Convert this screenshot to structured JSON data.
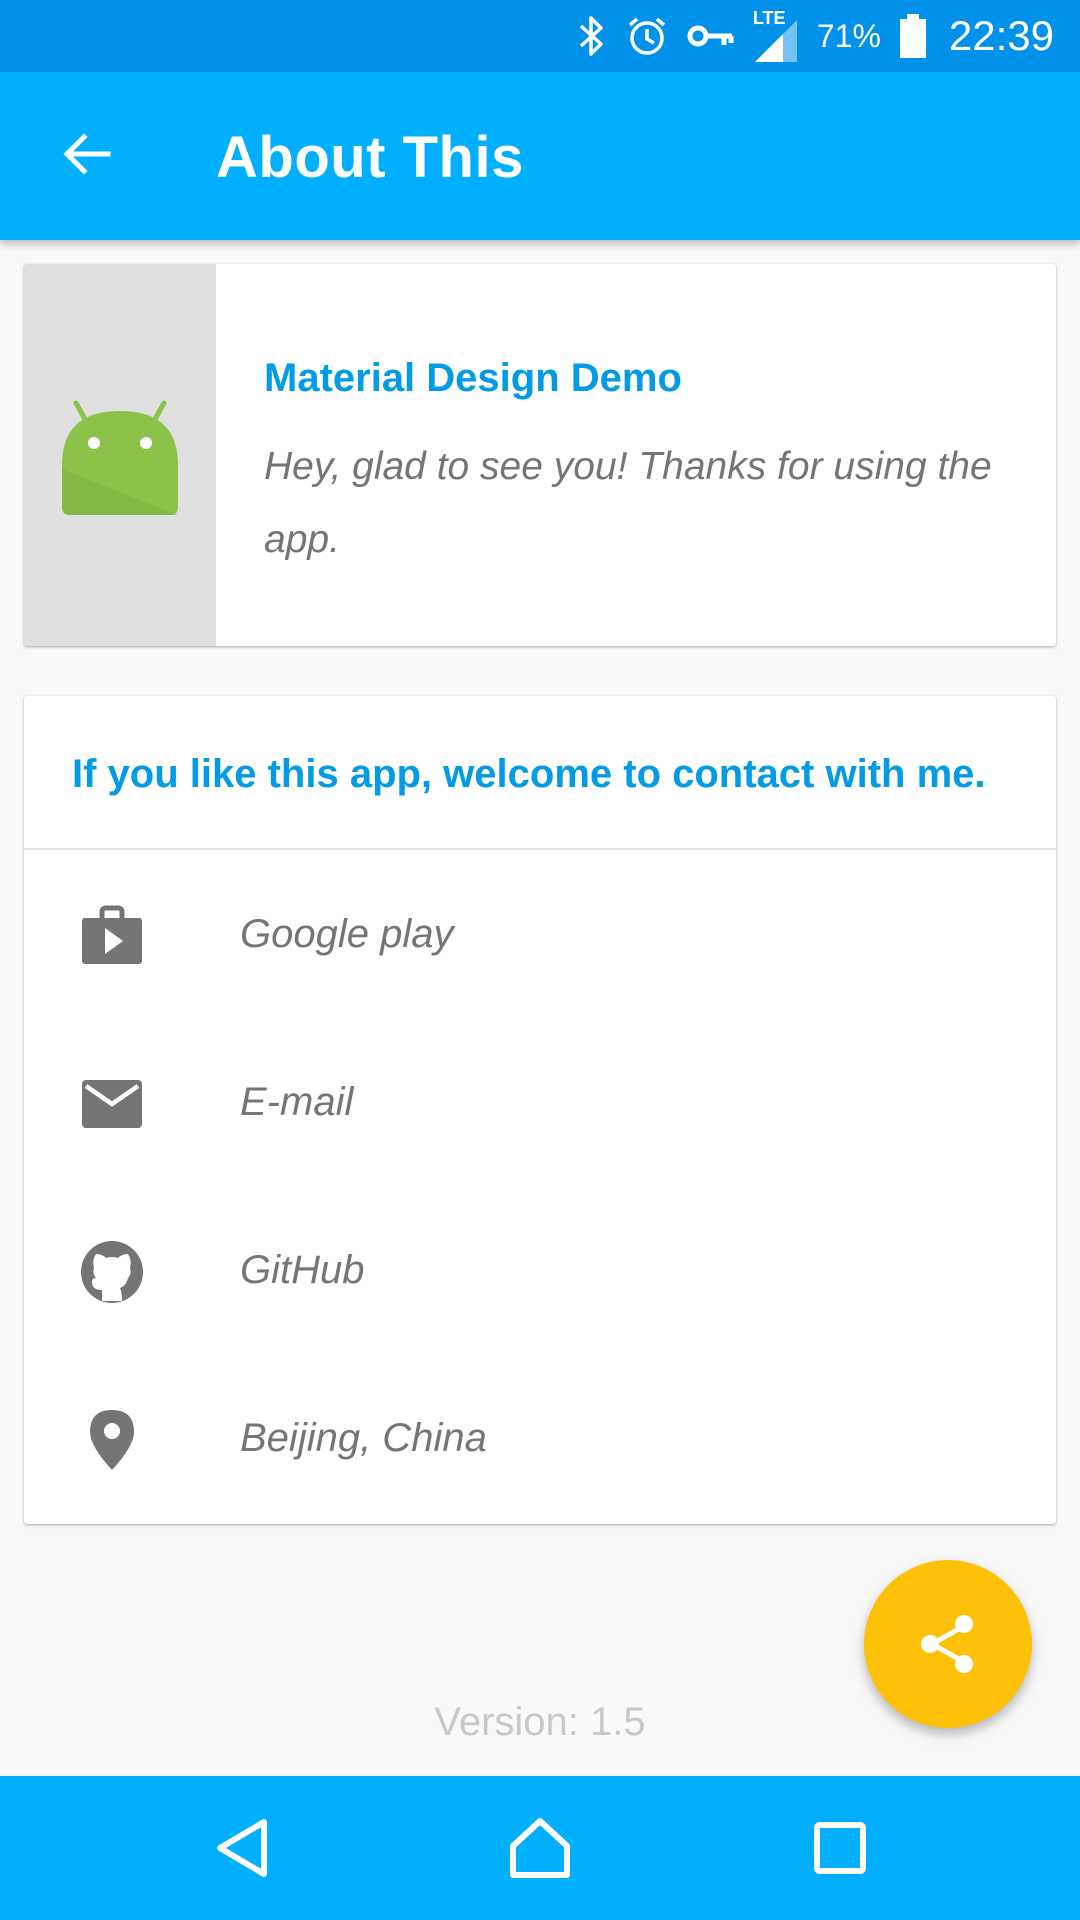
{
  "status_bar": {
    "network": "LTE",
    "battery": "71%",
    "time": "22:39",
    "icons": [
      "bluetooth-icon",
      "alarm-icon",
      "vpn-key-icon",
      "signal-icon",
      "battery-icon"
    ]
  },
  "app_bar": {
    "title": "About This",
    "back_icon": "arrow-back-icon"
  },
  "intro_card": {
    "logo_icon": "android-icon",
    "app_name": "Material Design Demo",
    "description": "Hey, glad to see you! Thanks for using the app."
  },
  "contact_card": {
    "heading": "If you like this app, welcome to contact with me.",
    "items": [
      {
        "icon": "google-play-icon",
        "label": "Google play"
      },
      {
        "icon": "email-icon",
        "label": "E-mail"
      },
      {
        "icon": "github-icon",
        "label": "GitHub"
      },
      {
        "icon": "location-pin-icon",
        "label": "Beijing, China"
      }
    ]
  },
  "version": "Version: 1.5",
  "fab": {
    "icon": "share-icon"
  },
  "nav_bar": {
    "buttons": [
      "back-triangle-icon",
      "home-icon",
      "recents-square-icon"
    ]
  },
  "colors": {
    "status_bar": "#0091ea",
    "app_bar": "#00b0ff",
    "accent_text": "#039be5",
    "fab": "#ffc107",
    "body_text": "#757575",
    "android_green": "#8bc34a"
  }
}
